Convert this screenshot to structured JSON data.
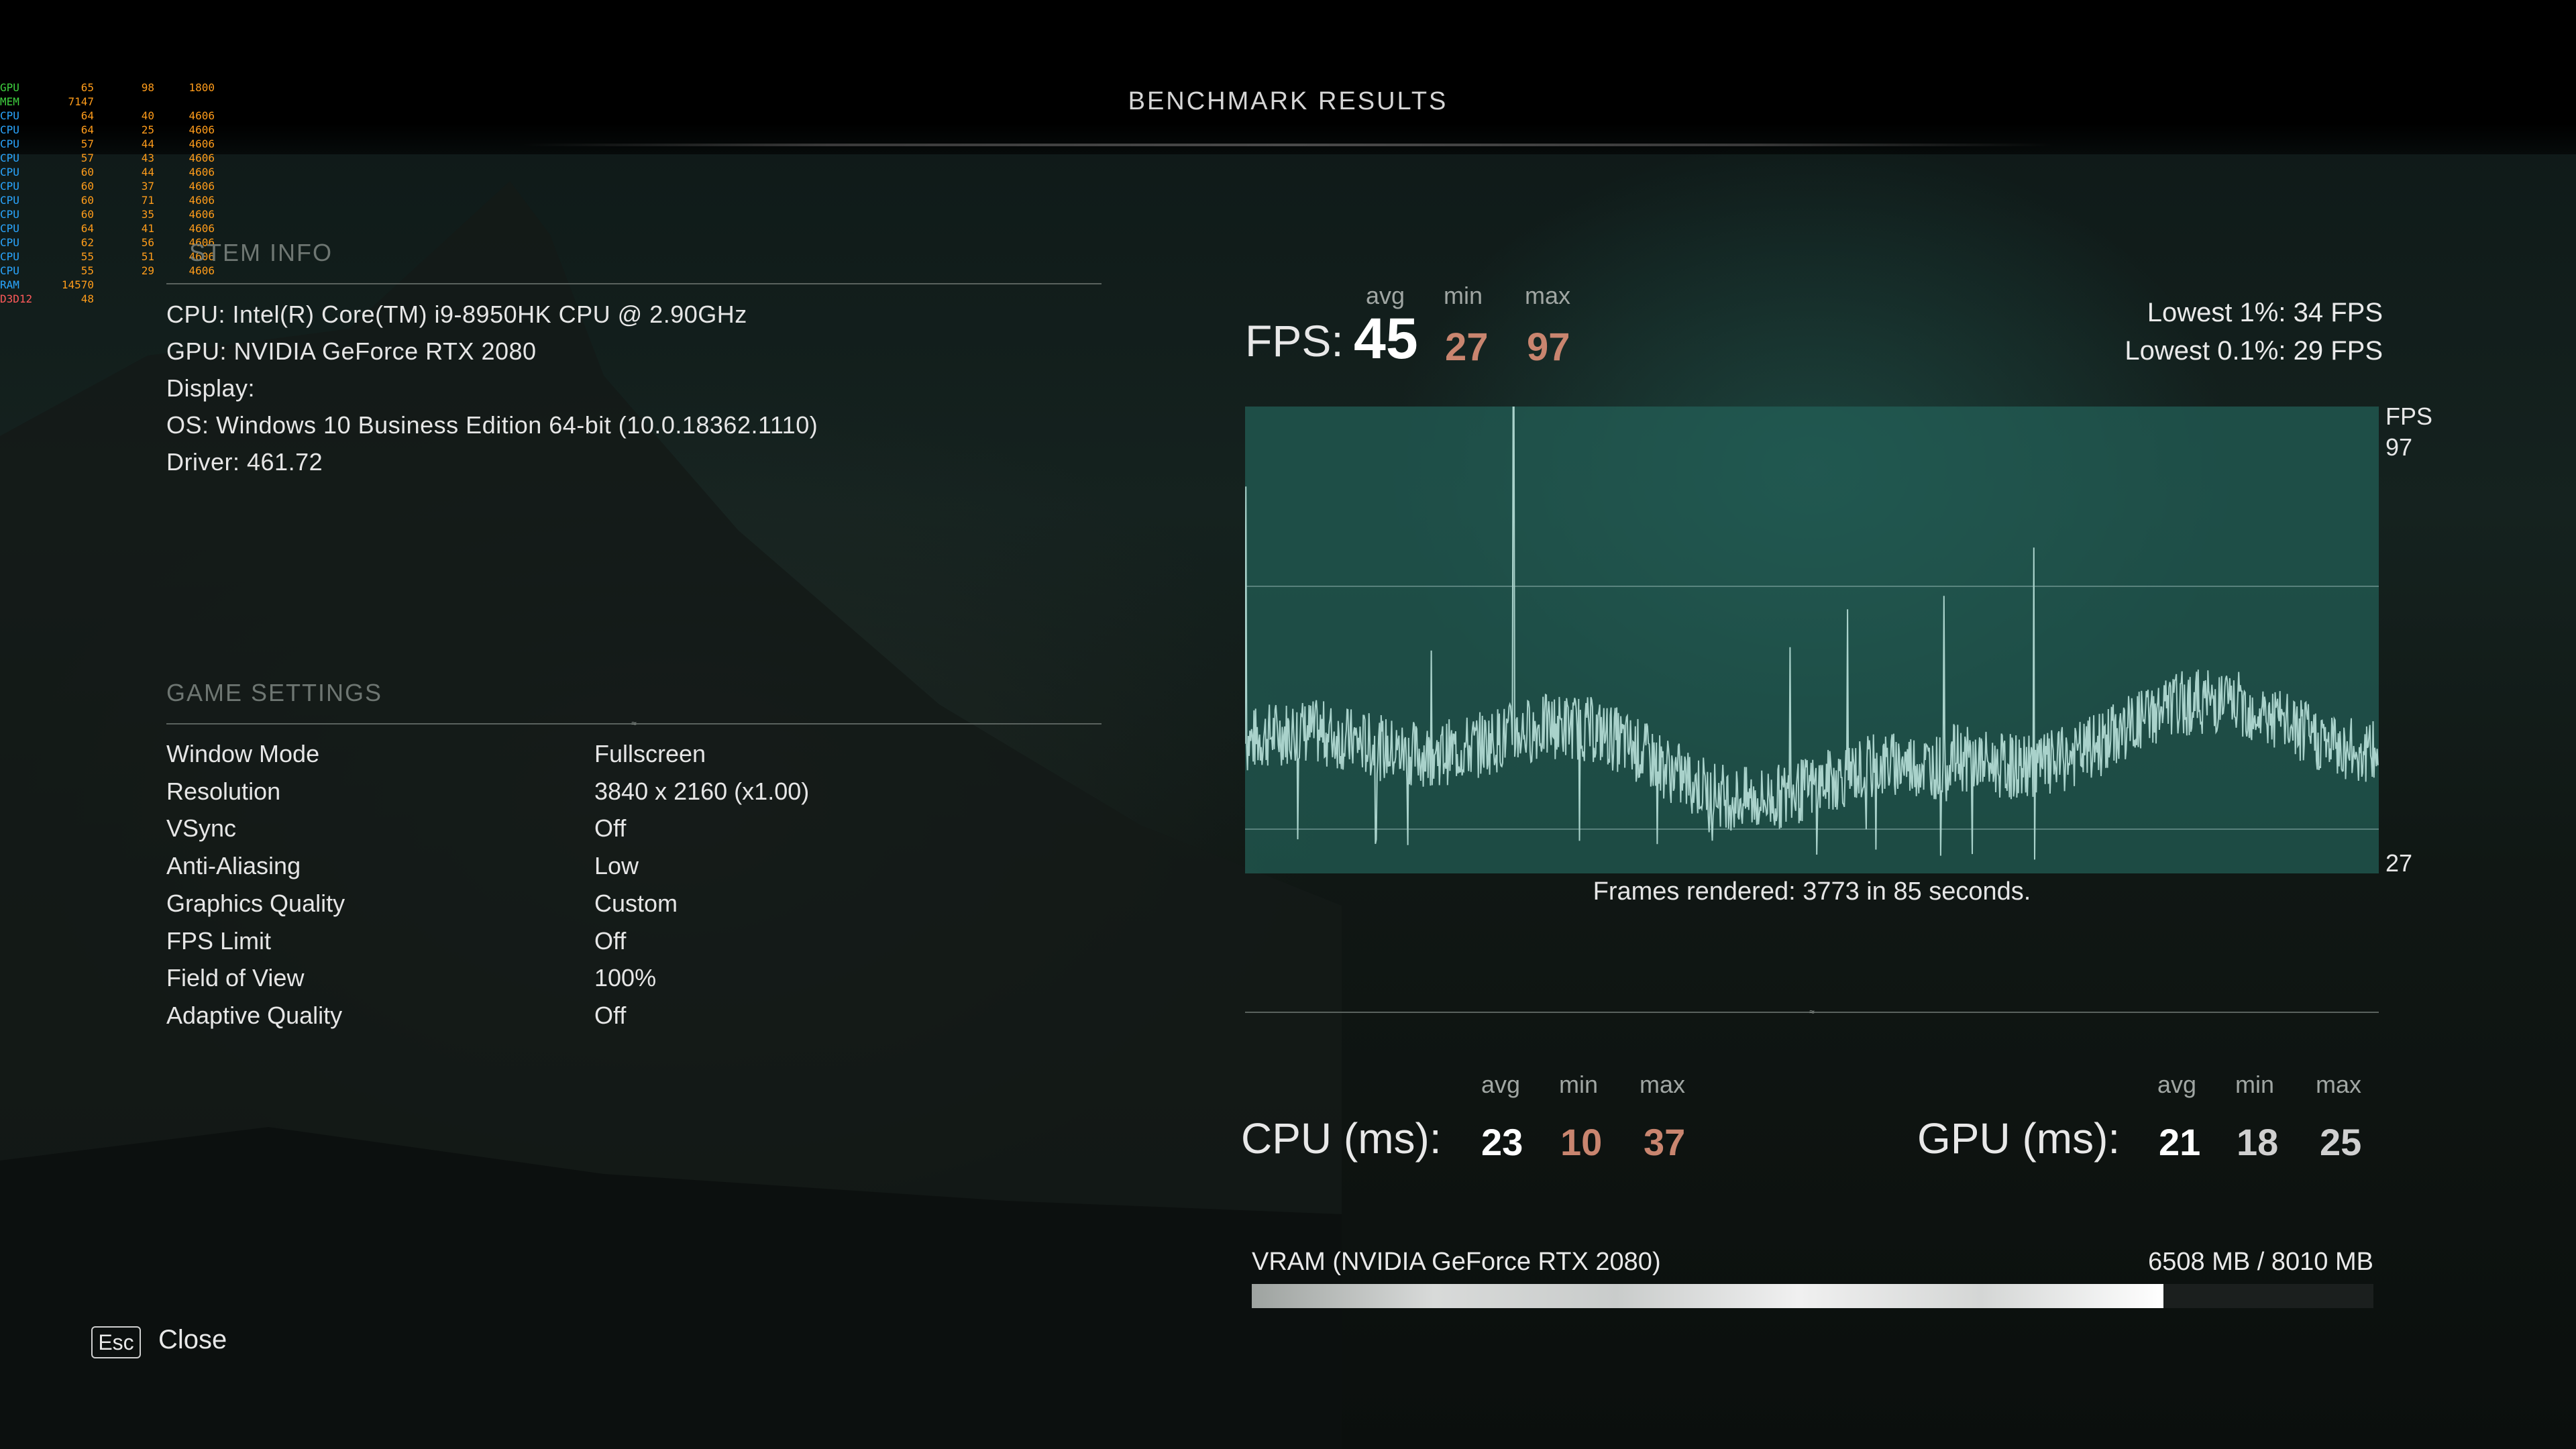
{
  "title": "BENCHMARK RESULTS",
  "osd": [
    {
      "name": "GPU",
      "v1": "65",
      "v2": "98",
      "v3": "1800",
      "color": "#3fd13f"
    },
    {
      "name": "MEM",
      "v1": "7147",
      "v2": "",
      "v3": "",
      "color": "#3fd13f"
    },
    {
      "name": "CPU",
      "v1": "64",
      "v2": "40",
      "v3": "4606",
      "color": "#2aa6ff"
    },
    {
      "name": "CPU",
      "v1": "64",
      "v2": "25",
      "v3": "4606",
      "color": "#2aa6ff"
    },
    {
      "name": "CPU",
      "v1": "57",
      "v2": "44",
      "v3": "4606",
      "color": "#2aa6ff"
    },
    {
      "name": "CPU",
      "v1": "57",
      "v2": "43",
      "v3": "4606",
      "color": "#2aa6ff"
    },
    {
      "name": "CPU",
      "v1": "60",
      "v2": "44",
      "v3": "4606",
      "color": "#2aa6ff"
    },
    {
      "name": "CPU",
      "v1": "60",
      "v2": "37",
      "v3": "4606",
      "color": "#2aa6ff"
    },
    {
      "name": "CPU",
      "v1": "60",
      "v2": "71",
      "v3": "4606",
      "color": "#2aa6ff"
    },
    {
      "name": "CPU",
      "v1": "60",
      "v2": "35",
      "v3": "4606",
      "color": "#2aa6ff"
    },
    {
      "name": "CPU",
      "v1": "64",
      "v2": "41",
      "v3": "4606",
      "color": "#2aa6ff"
    },
    {
      "name": "CPU",
      "v1": "62",
      "v2": "56",
      "v3": "4606",
      "color": "#2aa6ff"
    },
    {
      "name": "CPU",
      "v1": "55",
      "v2": "51",
      "v3": "4606",
      "color": "#2aa6ff"
    },
    {
      "name": "CPU",
      "v1": "55",
      "v2": "29",
      "v3": "4606",
      "color": "#2aa6ff"
    },
    {
      "name": "RAM",
      "v1": "14570",
      "v2": "",
      "v3": "",
      "color": "#2aa6ff"
    },
    {
      "name": "D3D12",
      "v1": "48",
      "v2": "",
      "v3": "",
      "color": "#ff5a5a"
    }
  ],
  "system_info": {
    "title": "STEM INFO",
    "cpu": "CPU: Intel(R) Core(TM) i9-8950HK CPU @ 2.90GHz",
    "gpu": "GPU: NVIDIA GeForce RTX 2080",
    "display": "Display:",
    "os": "OS: Windows 10 Business Edition 64-bit (10.0.18362.1110)",
    "driver": "Driver: 461.72"
  },
  "game_settings": {
    "title": "GAME SETTINGS",
    "items": [
      {
        "label": "Window Mode",
        "value": "Fullscreen"
      },
      {
        "label": "Resolution",
        "value": "3840 x 2160 (x1.00)"
      },
      {
        "label": "VSync",
        "value": "Off"
      },
      {
        "label": "Anti-Aliasing",
        "value": "Low"
      },
      {
        "label": "Graphics Quality",
        "value": "Custom"
      },
      {
        "label": "FPS Limit",
        "value": "Off"
      },
      {
        "label": "Field of View",
        "value": "100%"
      },
      {
        "label": "Adaptive Quality",
        "value": "Off"
      }
    ]
  },
  "fps": {
    "label": "FPS:",
    "avg_label": "avg",
    "min_label": "min",
    "max_label": "max",
    "avg": "45",
    "min": "27",
    "max": "97",
    "lowest1": "Lowest 1%: 34 FPS",
    "lowest01": "Lowest 0.1%: 29 FPS"
  },
  "chart_data": {
    "type": "line",
    "axis_title": "FPS",
    "ylim": [
      27,
      97
    ],
    "y_top_label": "97",
    "y_bottom_label": "27",
    "duration_seconds": 85,
    "frames_rendered": 3773,
    "caption": "Frames rendered: 3773 in 85 seconds.",
    "series_color": "#a9d2cb"
  },
  "cpu": {
    "label": "CPU (ms):",
    "avg_label": "avg",
    "min_label": "min",
    "max_label": "max",
    "avg": "23",
    "min": "10",
    "max": "37"
  },
  "gpu": {
    "label": "GPU (ms):",
    "avg_label": "avg",
    "min_label": "min",
    "max_label": "max",
    "avg": "21",
    "min": "18",
    "max": "25"
  },
  "vram": {
    "label": "VRAM (NVIDIA GeForce RTX 2080)",
    "value": "6508 MB / 8010 MB",
    "used_fraction": 0.8125
  },
  "close": {
    "key": "Esc",
    "label": "Close"
  },
  "colors": {
    "min_color": "#c9856f",
    "max_color": "#c9856f",
    "avg_color": "#ffffff",
    "gpu_minmax_color": "#d0d0d0"
  }
}
